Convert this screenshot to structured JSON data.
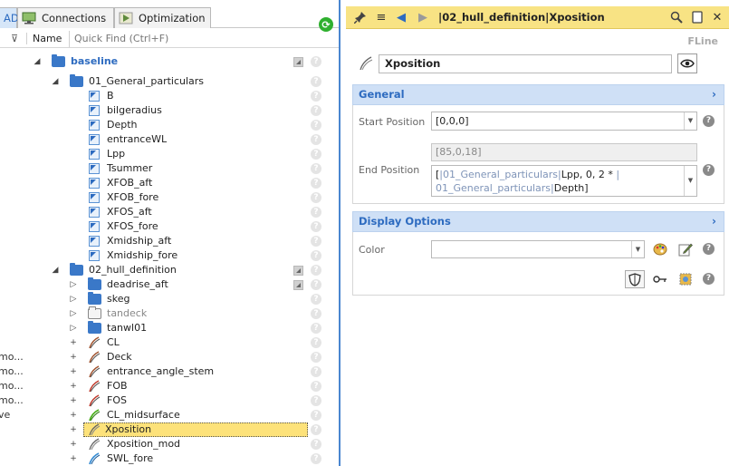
{
  "tabs": [
    {
      "label": "AD"
    },
    {
      "label": "Connections"
    },
    {
      "label": "Optimization"
    }
  ],
  "tree_header": {
    "name_col": "Name",
    "quickfind_placeholder": "Quick Find (Ctrl+F)"
  },
  "left_cutoff": [
    "mo...",
    "mo...",
    "mo...",
    "mo...",
    "ve"
  ],
  "tree": {
    "root": "baseline",
    "group1": "01_General_particulars",
    "params": [
      "B",
      "bilgeradius",
      "Depth",
      "entranceWL",
      "Lpp",
      "Tsummer",
      "XFOB_aft",
      "XFOB_fore",
      "XFOS_aft",
      "XFOS_fore",
      "Xmidship_aft",
      "Xmidship_fore"
    ],
    "group2": "02_hull_definition",
    "subfolders": [
      "deadrise_aft",
      "skeg",
      "tandeck",
      "tanwl01"
    ],
    "curves": [
      "CL",
      "Deck",
      "entrance_angle_stem",
      "FOB",
      "FOS",
      "CL_midsurface",
      "Xposition",
      "Xposition_mod",
      "SWL_fore"
    ]
  },
  "right": {
    "toolbar_title": "|02_hull_definition|Xposition",
    "type": "FLine",
    "name_value": "Xposition",
    "general": {
      "header": "General",
      "start_label": "Start Position",
      "start_value": "[0,0,0]",
      "end_label": "End Position",
      "end_computed": "[85,0,18]",
      "end_expr": {
        "open": "[",
        "ref1": "|01_General_particulars|",
        "mid1": "Lpp, 0, 2 * ",
        "ref2a": "|",
        "ref2b": "01_General_particulars|",
        "close": "Depth]"
      }
    },
    "display": {
      "header": "Display Options",
      "color_label": "Color",
      "color_value": ""
    }
  },
  "colors": {
    "accent": "#2d6bc0",
    "toolbar": "#f8e384",
    "selection": "#fde27a",
    "section_header": "#cfe0f6"
  }
}
